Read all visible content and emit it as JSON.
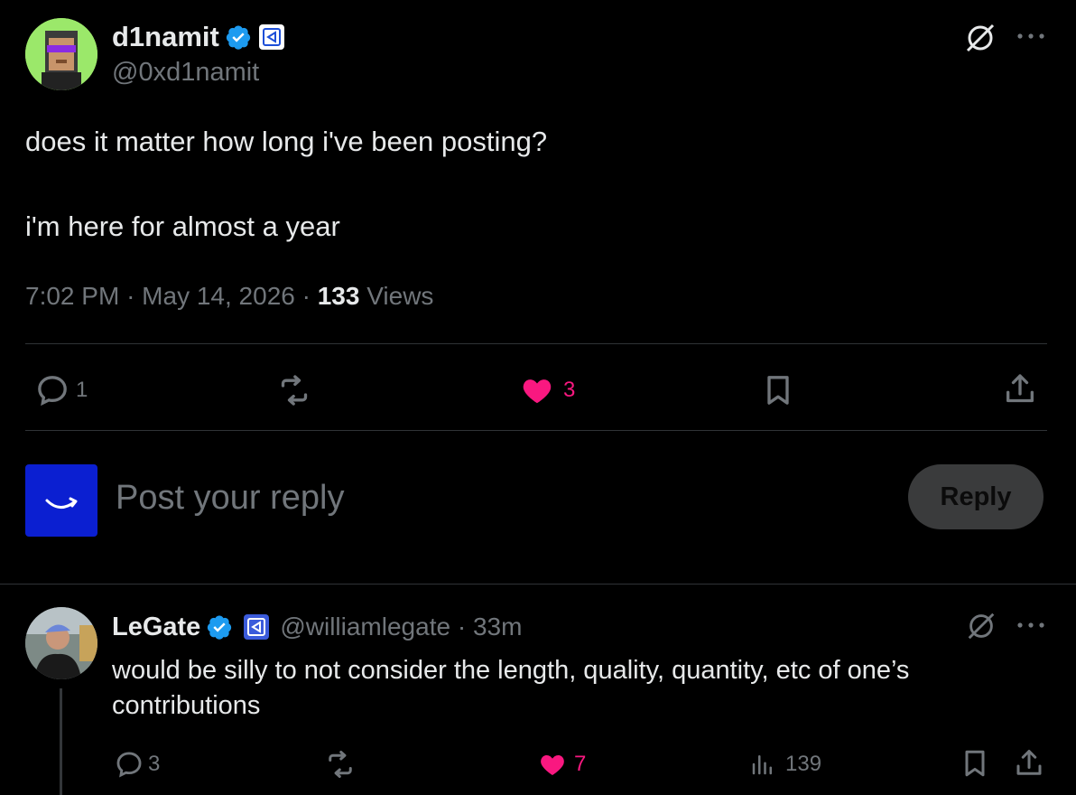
{
  "post": {
    "author_name": "d1namit",
    "author_handle": "@0xd1namit",
    "text_line1": "does it matter how long i've been posting?",
    "text_line2": "i'm here for almost a year",
    "time": "7:02 PM",
    "date": "May 14, 2026",
    "views_count": "133",
    "views_label": "Views",
    "actions": {
      "replies": "1",
      "likes": "3"
    }
  },
  "composer": {
    "placeholder": "Post your reply",
    "reply_label": "Reply"
  },
  "reply": {
    "author_name": "LeGate",
    "author_handle": "@williamlegate",
    "time_ago": "33m",
    "text_line1": "would be silly to not consider the length, quality, quantity, etc of one’s",
    "text_line2": "contributions",
    "actions": {
      "replies": "3",
      "likes": "7",
      "views": "139"
    }
  },
  "colors": {
    "background": "#000000",
    "text": "#e7e9ea",
    "muted": "#71767b",
    "verified": "#1d9bf0",
    "like": "#f91880",
    "divider": "#2f3336",
    "composer_avatar": "#0b1fd1"
  },
  "icons": [
    "grok-icon",
    "more-icon",
    "reply-icon",
    "repost-icon",
    "like-icon",
    "bookmark-icon",
    "share-icon",
    "analytics-icon",
    "verified-badge-icon",
    "affiliate-badge-icon"
  ]
}
